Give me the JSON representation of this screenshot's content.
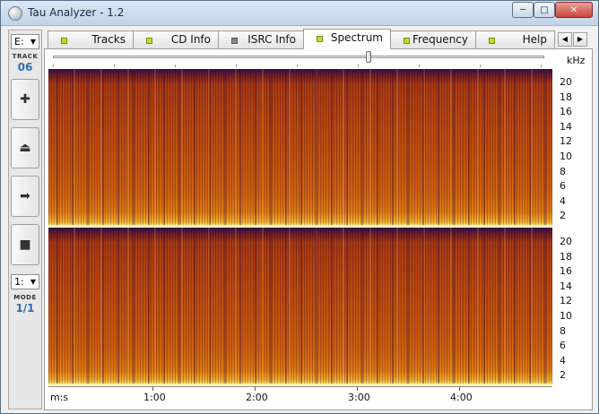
{
  "window": {
    "title": "Tau Analyzer - 1.2"
  },
  "sidebar": {
    "drive": "E:",
    "track_label": "TRACK",
    "track_value": "06",
    "ratio": "1:",
    "mode_label": "MODE",
    "mode_value": "1/1"
  },
  "tabs": [
    {
      "label": "Tracks",
      "indicator": "green"
    },
    {
      "label": "CD Info",
      "indicator": "green"
    },
    {
      "label": "ISRC Info",
      "indicator": "gray"
    },
    {
      "label": "Spectrum",
      "indicator": "green",
      "active": true
    },
    {
      "label": "Frequency",
      "indicator": "green"
    },
    {
      "label": "Help",
      "indicator": "green"
    }
  ],
  "spectrum": {
    "unit": "kHz",
    "freq_ticks": [
      "20",
      "18",
      "16",
      "14",
      "12",
      "10",
      "8",
      "6",
      "4",
      "2"
    ],
    "time_axis_label": "m:s",
    "time_ticks": [
      "1:00",
      "2:00",
      "3:00",
      "4:00"
    ],
    "zoom_slider_fraction": 0.64
  },
  "colors": {
    "spectrum_low": "#2e1048",
    "spectrum_high": "#ffe680",
    "track_value": "#2f6fb0"
  }
}
